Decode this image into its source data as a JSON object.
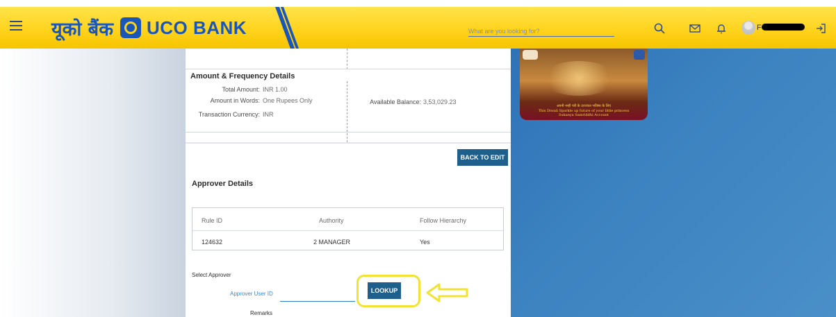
{
  "header": {
    "logo_hindi": "यूको बैंक",
    "logo_english": "UCO BANK",
    "search_placeholder": "What are you looking for?",
    "user_initial": "F",
    "icons": [
      "menu-icon",
      "search-icon",
      "mail-icon",
      "bell-icon",
      "user-avatar-icon",
      "logout-icon"
    ]
  },
  "amount_section": {
    "title": "Amount & Frequency Details",
    "fields": [
      {
        "label": "Total Amount:",
        "value": "INR 1.00"
      },
      {
        "label": "Amount in Words:",
        "value": "One Rupees Only"
      },
      {
        "label": "Transaction Currency:",
        "value": "INR"
      }
    ],
    "available_balance_label": "Available Balance:",
    "available_balance_value": "3,53,029.23"
  },
  "back_to_edit_label": "BACK TO EDIT",
  "approver_section": {
    "title": "Approver Details",
    "columns": [
      "Rule ID",
      "Authority",
      "Follow Hierarchy"
    ],
    "rows": [
      [
        "124632",
        "2 MANAGER",
        "Yes"
      ]
    ],
    "select_label": "Select Approver",
    "user_id_label": "Approver User ID",
    "user_id_value": "",
    "lookup_label": "LOOKUP",
    "remarks_label": "Remarks"
  },
  "banner": {
    "line1": "अपनी नन्ही परी के उज्ज्वल भविष्य के लिए",
    "line2": "This Diwali Sparkle up future of your little princess",
    "line3": "Sukanya Samriddhi Account"
  },
  "colors": {
    "header_yellow": "#ffd21a",
    "brand_blue": "#1a56b8",
    "button_blue": "#1f5f8b",
    "highlight_yellow": "#f2e234"
  }
}
